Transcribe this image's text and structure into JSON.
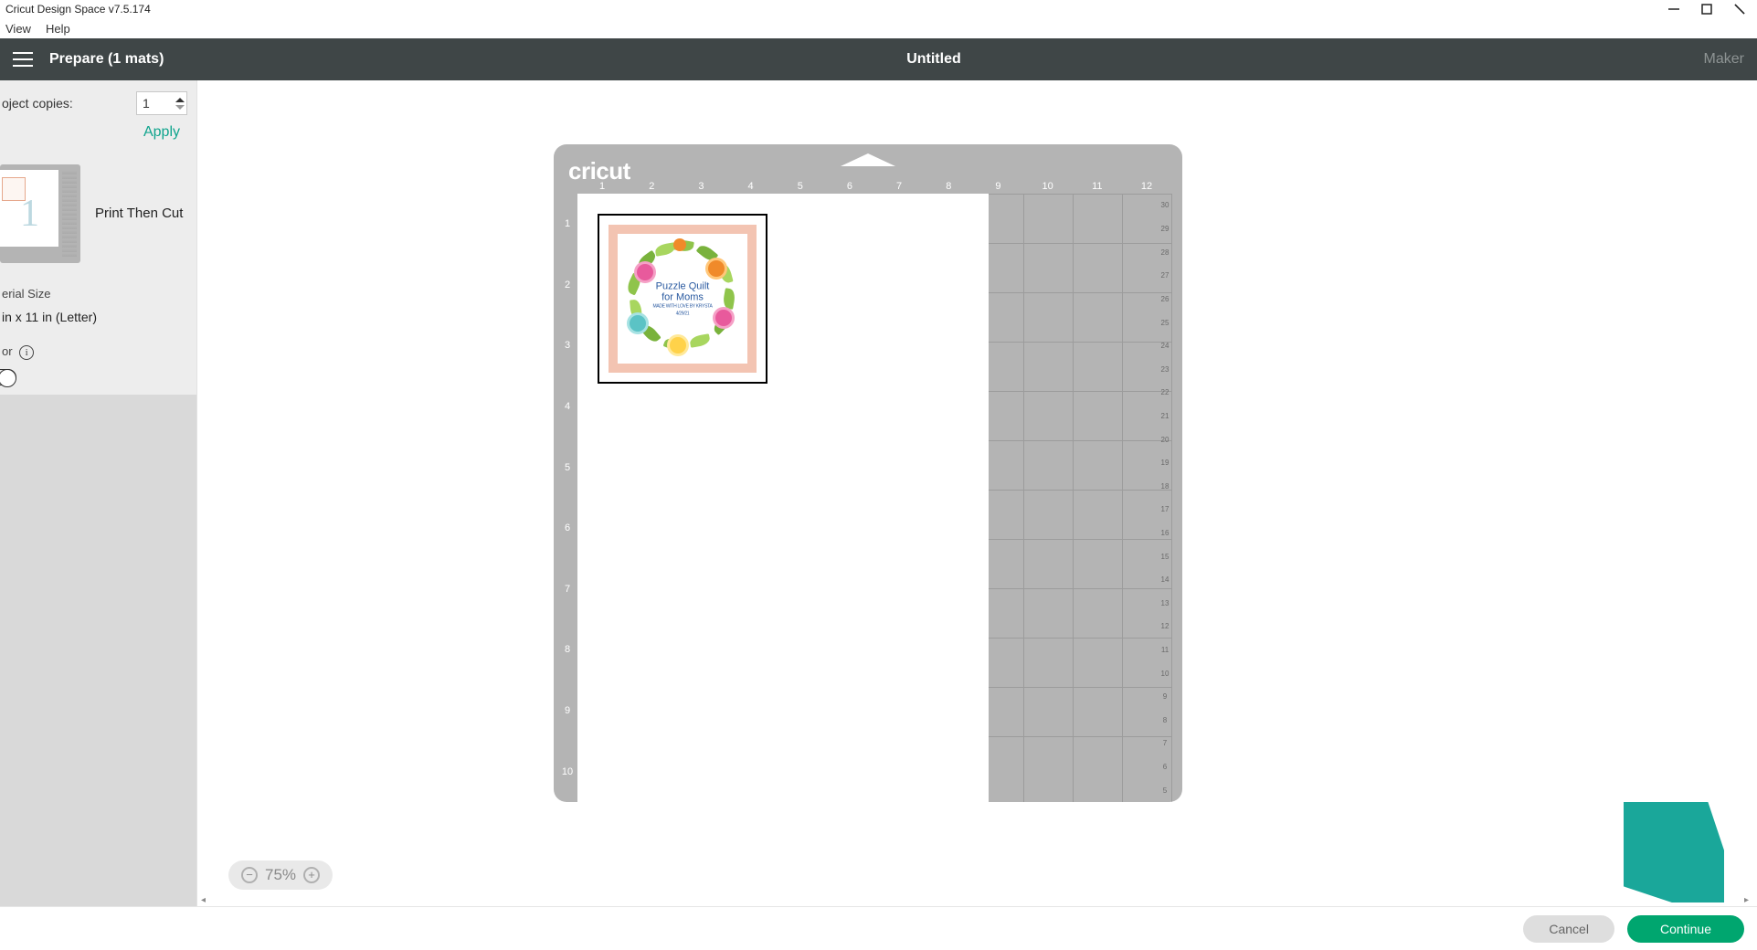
{
  "window": {
    "title": "Cricut Design Space  v7.5.174"
  },
  "menubar": {
    "view": "View",
    "help": "Help"
  },
  "header": {
    "prepare": "Prepare (1 mats)",
    "projectTitle": "Untitled",
    "device": "Maker"
  },
  "sidebar": {
    "copiesLabel": "oject copies:",
    "copiesValue": "1",
    "applyLabel": "Apply",
    "matOperation": "Print Then Cut",
    "matNumber": "1",
    "materialSizeLabel": "erial Size",
    "materialSizeValue": " in x 11 in (Letter)",
    "mirrorLabel": "or"
  },
  "zoom": {
    "level": "75%"
  },
  "mat": {
    "brand": "cricut",
    "rulerX": [
      "1",
      "2",
      "3",
      "4",
      "5",
      "6",
      "7",
      "8",
      "9",
      "10",
      "11",
      "12"
    ],
    "rulerY": [
      "1",
      "2",
      "3",
      "4",
      "5",
      "6",
      "7",
      "8",
      "9",
      "10"
    ],
    "rulerRight": [
      "30",
      "29",
      "28",
      "27",
      "26",
      "25",
      "24",
      "23",
      "22",
      "21",
      "20",
      "19",
      "18",
      "17",
      "16",
      "15",
      "14",
      "13",
      "12",
      "11",
      "10",
      "9",
      "8",
      "7",
      "6",
      "5"
    ],
    "design": {
      "line1": "Puzzle Quilt",
      "line2": "for Moms",
      "line3": "MADE WITH LOVE BY KRYSTA",
      "line4": "4/29/21"
    }
  },
  "footer": {
    "cancel": "Cancel",
    "continue": "Continue"
  }
}
